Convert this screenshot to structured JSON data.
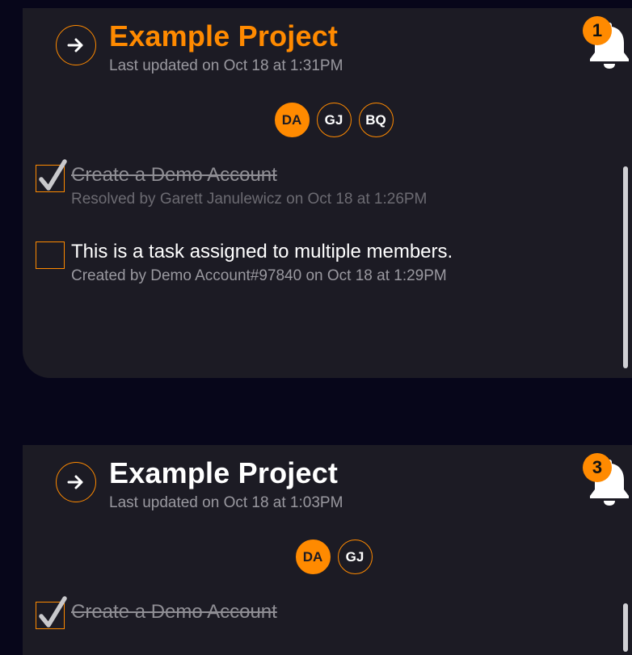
{
  "projects": [
    {
      "title": "Example Project",
      "last_updated": "Last updated on Oct 18 at 1:31PM",
      "notifications": "1",
      "members": [
        {
          "initials": "DA",
          "active": true
        },
        {
          "initials": "GJ",
          "active": false
        },
        {
          "initials": "BQ",
          "active": false
        }
      ],
      "tasks": [
        {
          "text": "Create a Demo Account",
          "meta": "Resolved by Garett Janulewicz on Oct 18 at 1:26PM",
          "done": true
        },
        {
          "text": "This is a task assigned to multiple members.",
          "meta": "Created by Demo Account#97840 on Oct 18 at 1:29PM",
          "done": false
        }
      ]
    },
    {
      "title": "Example Project",
      "last_updated": "Last updated on Oct 18 at 1:03PM",
      "notifications": "3",
      "members": [
        {
          "initials": "DA",
          "active": true
        },
        {
          "initials": "GJ",
          "active": false
        }
      ],
      "tasks": [
        {
          "text": "Create a Demo Account",
          "done": true
        }
      ]
    }
  ],
  "colors": {
    "accent": "#ff8a00",
    "card": "#1c1b24",
    "background": "#07061a"
  },
  "icons": {
    "open": "arrow-right-icon",
    "notifications": "bell-icon",
    "checked": "checkmark-icon"
  }
}
